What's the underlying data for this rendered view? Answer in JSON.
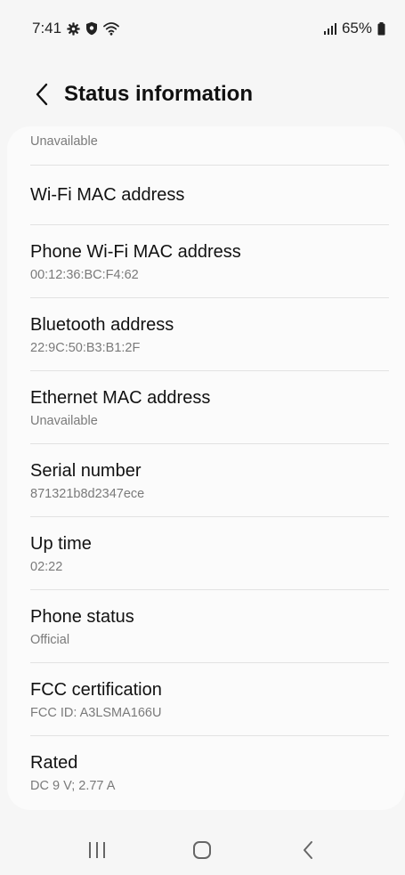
{
  "status_bar": {
    "time": "7:41",
    "battery": "65%",
    "icons": [
      "gear-icon",
      "shield-icon",
      "wifi-icon",
      "signal-icon",
      "battery-icon"
    ]
  },
  "header": {
    "title": "Status information",
    "back_icon": "chevron-left-icon"
  },
  "rows": {
    "prev_value": "Unavailable",
    "wifi_mac": {
      "title": "Wi-Fi MAC address"
    },
    "phone_wifi_mac": {
      "title": "Phone Wi-Fi MAC address",
      "value": "00:12:36:BC:F4:62"
    },
    "bluetooth": {
      "title": "Bluetooth address",
      "value": "22:9C:50:B3:B1:2F"
    },
    "ethernet": {
      "title": "Ethernet MAC address",
      "value": "Unavailable"
    },
    "serial": {
      "title": "Serial number",
      "value": "871321b8d2347ece"
    },
    "uptime": {
      "title": "Up time",
      "value": "02:22"
    },
    "phone_status": {
      "title": "Phone status",
      "value": "Official"
    },
    "fcc": {
      "title": "FCC certification",
      "value": "FCC ID: A3LSMA166U"
    },
    "rated": {
      "title": "Rated",
      "value": "DC 9 V; 2.77 A"
    }
  },
  "nav_bar": {
    "icons": [
      "recents-icon",
      "home-icon",
      "back-icon"
    ]
  },
  "colors": {
    "background": "#f6f6f6",
    "card": "#fbfbfb",
    "divider": "#e2e2e2",
    "secondary_text": "#7a7a7a"
  }
}
